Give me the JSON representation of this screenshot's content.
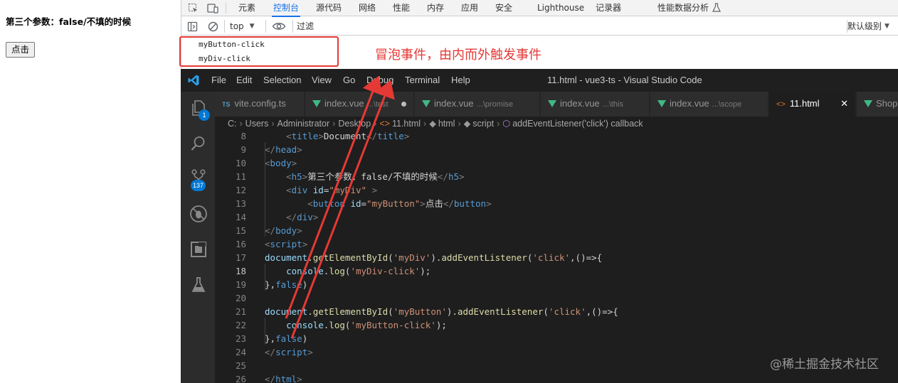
{
  "page": {
    "heading": "第三个参数：false/不填的时候",
    "button_label": "点击"
  },
  "devtools": {
    "tabs": [
      "元素",
      "控制台",
      "源代码",
      "网络",
      "性能",
      "内存",
      "应用",
      "安全",
      "Lighthouse",
      "记录器",
      "性能数据分析"
    ],
    "active_tab": "控制台",
    "context": "top",
    "filter_placeholder": "过滤",
    "levels": "默认级别",
    "logs": [
      "myButton-click",
      "myDiv-click"
    ]
  },
  "annotation": {
    "text": "冒泡事件，由内而外触发事件",
    "color": "#e53935"
  },
  "vscode": {
    "menu": [
      "File",
      "Edit",
      "Selection",
      "View",
      "Go",
      "Debug",
      "Terminal",
      "Help"
    ],
    "title": "11.html - vue3-ts - Visual Studio Code",
    "activity_badges": [
      "1",
      "137"
    ],
    "tabs": [
      {
        "label": "vite.config.ts",
        "dir": "",
        "icon": "ts"
      },
      {
        "label": "index.vue",
        "dir": "...\\test",
        "icon": "vue",
        "modified": true
      },
      {
        "label": "index.vue",
        "dir": "...\\promise",
        "icon": "vue"
      },
      {
        "label": "index.vue",
        "dir": "...\\this",
        "icon": "vue"
      },
      {
        "label": "index.vue",
        "dir": "...\\scope",
        "icon": "vue"
      },
      {
        "label": "11.html",
        "dir": "",
        "icon": "html",
        "active": true
      },
      {
        "label": "Shop.vue",
        "dir": "",
        "icon": "vue"
      }
    ],
    "breadcrumb": [
      "C:",
      "Users",
      "Administrator",
      "Desktop",
      "11.html",
      "html",
      "script",
      "addEventListener('click') callback"
    ],
    "current_line": 18,
    "code": [
      {
        "n": 8,
        "t": [
          [
            "    ",
            "plain"
          ],
          [
            "<",
            "punct"
          ],
          [
            "title",
            "tag"
          ],
          [
            ">",
            "punct"
          ],
          [
            "Document",
            "text"
          ],
          [
            "</",
            "punct"
          ],
          [
            "title",
            "tag"
          ],
          [
            ">",
            "punct"
          ]
        ]
      },
      {
        "n": 9,
        "t": [
          [
            "</",
            "punct"
          ],
          [
            "head",
            "tag"
          ],
          [
            ">",
            "punct"
          ]
        ]
      },
      {
        "n": 10,
        "t": [
          [
            "<",
            "punct"
          ],
          [
            "body",
            "tag"
          ],
          [
            ">",
            "punct"
          ]
        ]
      },
      {
        "n": 11,
        "t": [
          [
            "    ",
            "plain"
          ],
          [
            "<",
            "punct"
          ],
          [
            "h5",
            "tag"
          ],
          [
            ">",
            "punct"
          ],
          [
            "第三个参数：false/不填的时候",
            "text"
          ],
          [
            "</",
            "punct"
          ],
          [
            "h5",
            "tag"
          ],
          [
            ">",
            "punct"
          ]
        ]
      },
      {
        "n": 12,
        "t": [
          [
            "    ",
            "plain"
          ],
          [
            "<",
            "punct"
          ],
          [
            "div",
            "tag"
          ],
          [
            " ",
            "plain"
          ],
          [
            "id",
            "attr"
          ],
          [
            "=",
            "plain"
          ],
          [
            "\"myDiv\"",
            "str"
          ],
          [
            " ",
            "plain"
          ],
          [
            ">",
            "punct"
          ]
        ]
      },
      {
        "n": 13,
        "t": [
          [
            "        ",
            "plain"
          ],
          [
            "<",
            "punct"
          ],
          [
            "button",
            "tag"
          ],
          [
            " ",
            "plain"
          ],
          [
            "id",
            "attr"
          ],
          [
            "=",
            "plain"
          ],
          [
            "\"myButton\"",
            "str"
          ],
          [
            ">",
            "punct"
          ],
          [
            "点击",
            "text"
          ],
          [
            "</",
            "punct"
          ],
          [
            "button",
            "tag"
          ],
          [
            ">",
            "punct"
          ]
        ]
      },
      {
        "n": 14,
        "t": [
          [
            "    ",
            "plain"
          ],
          [
            "</",
            "punct"
          ],
          [
            "div",
            "tag"
          ],
          [
            ">",
            "punct"
          ]
        ]
      },
      {
        "n": 15,
        "t": [
          [
            "</",
            "punct"
          ],
          [
            "body",
            "tag"
          ],
          [
            ">",
            "punct"
          ]
        ]
      },
      {
        "n": 16,
        "t": [
          [
            "<",
            "punct"
          ],
          [
            "script",
            "tag"
          ],
          [
            ">",
            "punct"
          ]
        ]
      },
      {
        "n": 17,
        "t": [
          [
            "document",
            "ident"
          ],
          [
            ".",
            "plain"
          ],
          [
            "getElementById",
            "fn"
          ],
          [
            "(",
            "plain"
          ],
          [
            "'myDiv'",
            "str"
          ],
          [
            ").",
            "plain"
          ],
          [
            "addEventListener",
            "fn"
          ],
          [
            "(",
            "plain"
          ],
          [
            "'click'",
            "str"
          ],
          [
            ",()=>{",
            "plain"
          ]
        ]
      },
      {
        "n": 18,
        "t": [
          [
            "    ",
            "plain"
          ],
          [
            "console",
            "ident"
          ],
          [
            ".",
            "plain"
          ],
          [
            "log",
            "fn"
          ],
          [
            "(",
            "plain"
          ],
          [
            "'myDiv-click'",
            "str"
          ],
          [
            ");",
            "plain"
          ]
        ]
      },
      {
        "n": 19,
        "t": [
          [
            "},",
            "plain"
          ],
          [
            "false",
            "kw"
          ],
          [
            ")",
            "plain"
          ]
        ]
      },
      {
        "n": 20,
        "t": []
      },
      {
        "n": 21,
        "t": [
          [
            "document",
            "ident"
          ],
          [
            ".",
            "plain"
          ],
          [
            "getElementById",
            "fn"
          ],
          [
            "(",
            "plain"
          ],
          [
            "'myButton'",
            "str"
          ],
          [
            ").",
            "plain"
          ],
          [
            "addEventListener",
            "fn"
          ],
          [
            "(",
            "plain"
          ],
          [
            "'click'",
            "str"
          ],
          [
            ",()=>{",
            "plain"
          ]
        ]
      },
      {
        "n": 22,
        "t": [
          [
            "    ",
            "plain"
          ],
          [
            "console",
            "ident"
          ],
          [
            ".",
            "plain"
          ],
          [
            "log",
            "fn"
          ],
          [
            "(",
            "plain"
          ],
          [
            "'myButton-click'",
            "str"
          ],
          [
            ");",
            "plain"
          ]
        ]
      },
      {
        "n": 23,
        "t": [
          [
            "},",
            "plain"
          ],
          [
            "false",
            "kw"
          ],
          [
            ")",
            "plain"
          ]
        ]
      },
      {
        "n": 24,
        "t": [
          [
            "</",
            "punct"
          ],
          [
            "script",
            "tag"
          ],
          [
            ">",
            "punct"
          ]
        ]
      },
      {
        "n": 25,
        "t": []
      },
      {
        "n": 26,
        "t": [
          [
            "</",
            "punct"
          ],
          [
            "html",
            "tag"
          ],
          [
            ">",
            "punct"
          ]
        ]
      }
    ]
  },
  "watermark": "@稀土掘金技术社区"
}
